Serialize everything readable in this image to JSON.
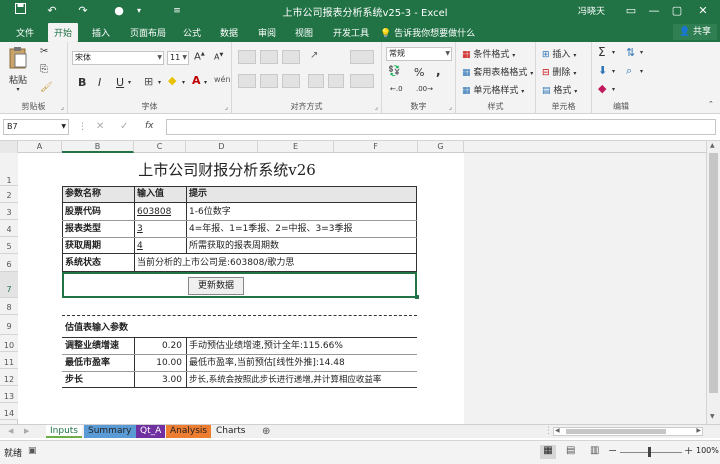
{
  "titlebar": {
    "doc_title": "上市公司报表分析系统v25-3  -  Excel",
    "user": "冯晓天",
    "icons": [
      "save-icon",
      "undo-icon",
      "redo-icon",
      "touch-mode-icon",
      "customize-icon"
    ]
  },
  "menu": {
    "tabs": [
      "文件",
      "开始",
      "插入",
      "页面布局",
      "公式",
      "数据",
      "审阅",
      "视图",
      "开发工具"
    ],
    "active": "开始",
    "tellme": "告诉我你想要做什么",
    "share": "共享"
  },
  "ribbon": {
    "clipboard": {
      "paste": "粘贴",
      "label": "剪贴板"
    },
    "font": {
      "name": "宋体",
      "size": "11",
      "grow": "A",
      "shrink": "A",
      "label": "字体",
      "bold": "B",
      "italic": "I",
      "underline": "U",
      "wen": "wén"
    },
    "alignment": {
      "label": "对齐方式"
    },
    "number": {
      "format": "常规",
      "percent": "%",
      "comma": ",",
      "label": "数字"
    },
    "styles": {
      "cond": "条件格式",
      "table": "套用表格格式",
      "cell": "单元格样式",
      "label": "样式"
    },
    "cells": {
      "insert": "插入",
      "delete": "删除",
      "format": "格式",
      "label": "单元格"
    },
    "editing": {
      "label": "编辑"
    }
  },
  "formula_bar": {
    "name_box": "B7",
    "fx": "fx",
    "value": ""
  },
  "grid": {
    "columns": [
      "A",
      "B",
      "C",
      "D",
      "E",
      "F",
      "G"
    ],
    "rows": [
      "1",
      "2",
      "3",
      "4",
      "5",
      "6",
      "7",
      "8",
      "9",
      "10",
      "11",
      "12",
      "13",
      "14"
    ]
  },
  "sheet": {
    "title": "上市公司财报分析系统v26",
    "headers": [
      "参数名称",
      "输入值",
      "提示"
    ],
    "params": [
      {
        "name": "股票代码",
        "value": "603808",
        "hint": "1-6位数字"
      },
      {
        "name": "报表类型",
        "value": "3",
        "hint": "4=年报、1=1季报、2=中报、3=3季报"
      },
      {
        "name": "获取周期",
        "value": "4",
        "hint": "所需获取的报表周期数"
      }
    ],
    "status_label": "系统状态",
    "status_value": "当前分析的上市公司是:603808/歌力思",
    "update_button": "更新数据",
    "valuation_title": "估值表输入参数",
    "valuation": [
      {
        "name": "调整业绩增速",
        "value": "0.20",
        "hint": "手动预估业绩增速,预计全年:115.66%"
      },
      {
        "name": "最低市盈率",
        "value": "10.00",
        "hint": "最低市盈率,当前预估[线性外推]:14.48"
      },
      {
        "name": "步长",
        "value": "3.00",
        "hint": "步长,系统会按照此步长进行递增,并计算相应收益率"
      }
    ]
  },
  "sheet_tabs": [
    {
      "name": "Inputs",
      "color": "#ffffff",
      "active": true
    },
    {
      "name": "Summary",
      "color": "#5b9bd5"
    },
    {
      "name": "Qt_A",
      "color": "#7030a0"
    },
    {
      "name": "Analysis",
      "color": "#ed7d31"
    },
    {
      "name": "Charts",
      "color": "#f0f0f0"
    }
  ],
  "status": {
    "ready": "就绪",
    "zoom": "100%"
  },
  "colors": {
    "brand": "#217346"
  }
}
